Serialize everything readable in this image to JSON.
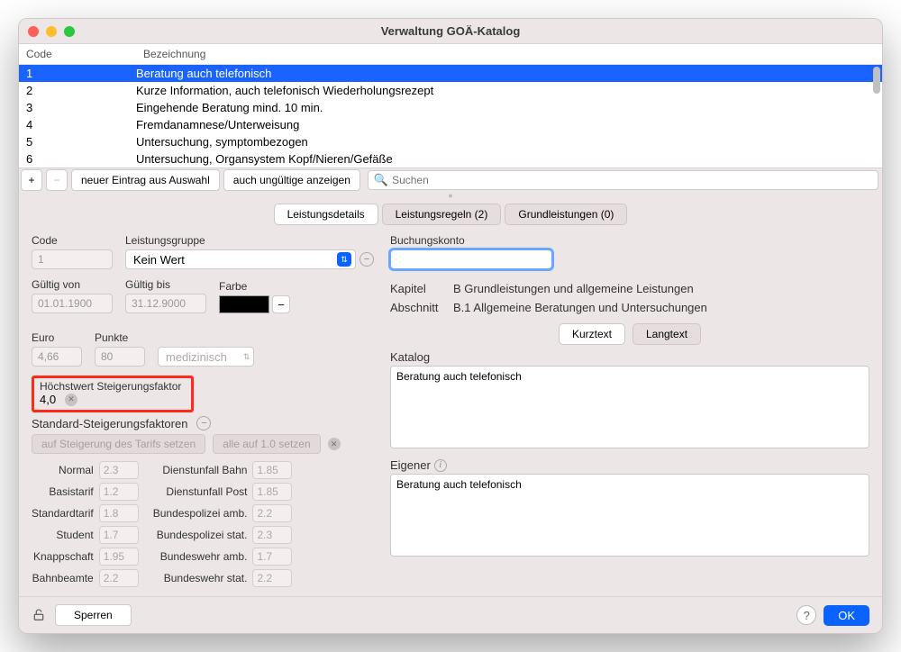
{
  "window": {
    "title": "Verwaltung GOÄ-Katalog"
  },
  "table": {
    "headers": {
      "code": "Code",
      "bez": "Bezeichnung"
    },
    "rows": [
      {
        "code": "1",
        "bez": "Beratung auch telefonisch",
        "selected": true
      },
      {
        "code": "2",
        "bez": "Kurze Information, auch telefonisch Wiederholungsrezept"
      },
      {
        "code": "3",
        "bez": "Eingehende Beratung mind. 10 min."
      },
      {
        "code": "4",
        "bez": "Fremdanamnese/Unterweisung"
      },
      {
        "code": "5",
        "bez": "Untersuchung, symptombezogen"
      },
      {
        "code": "6",
        "bez": "Untersuchung, Organsystem Kopf/Nieren/Gefäße"
      }
    ]
  },
  "toolbar": {
    "plus": "+",
    "minus": "−",
    "new_from_selection": "neuer Eintrag aus Auswahl",
    "show_invalid": "auch ungültige anzeigen",
    "search_placeholder": "Suchen"
  },
  "tabs": {
    "details": "Leistungsdetails",
    "rules": "Leistungsregeln (2)",
    "base": "Grundleistungen (0)"
  },
  "details": {
    "code_label": "Code",
    "code_value": "1",
    "group_label": "Leistungsgruppe",
    "group_value": "Kein Wert",
    "valid_from_label": "Gültig von",
    "valid_from": "01.01.1900",
    "valid_to_label": "Gültig bis",
    "valid_to": "31.12.9000",
    "color_label": "Farbe",
    "euro_label": "Euro",
    "euro": "4,66",
    "points_label": "Punkte",
    "points": "80",
    "type_value": "medizinisch",
    "max_factor_label": "Höchstwert Steigerungsfaktor",
    "max_factor": "4,0",
    "std_factors_label": "Standard-Steigerungsfaktoren",
    "set_tariff": "auf Steigerung des Tarifs setzen",
    "set_one": "alle auf 1.0 setzen",
    "factors_left": [
      {
        "label": "Normal",
        "value": "2.3"
      },
      {
        "label": "Basistarif",
        "value": "1.2"
      },
      {
        "label": "Standardtarif",
        "value": "1.8"
      },
      {
        "label": "Student",
        "value": "1.7"
      },
      {
        "label": "Knappschaft",
        "value": "1.95"
      },
      {
        "label": "Bahnbeamte",
        "value": "2.2"
      }
    ],
    "factors_right": [
      {
        "label": "Dienstunfall Bahn",
        "value": "1.85"
      },
      {
        "label": "Dienstunfall Post",
        "value": "1.85"
      },
      {
        "label": "Bundespolizei amb.",
        "value": "2.2"
      },
      {
        "label": "Bundespolizei stat.",
        "value": "2.3"
      },
      {
        "label": "Bundeswehr amb.",
        "value": "1.7"
      },
      {
        "label": "Bundeswehr stat.",
        "value": "2.2"
      }
    ]
  },
  "right": {
    "account_label": "Buchungskonto",
    "account_value": "",
    "kapitel_label": "Kapitel",
    "kapitel": "B Grundleistungen und allgemeine Leistungen",
    "abschnitt_label": "Abschnitt",
    "abschnitt": "B.1 Allgemeine Beratungen und Untersuchungen",
    "short_tab": "Kurztext",
    "long_tab": "Langtext",
    "katalog_label": "Katalog",
    "katalog_text": "Beratung auch telefonisch",
    "eigener_label": "Eigener",
    "eigener_text": "Beratung auch telefonisch"
  },
  "footer": {
    "lock": "Sperren",
    "ok": "OK",
    "help": "?"
  }
}
